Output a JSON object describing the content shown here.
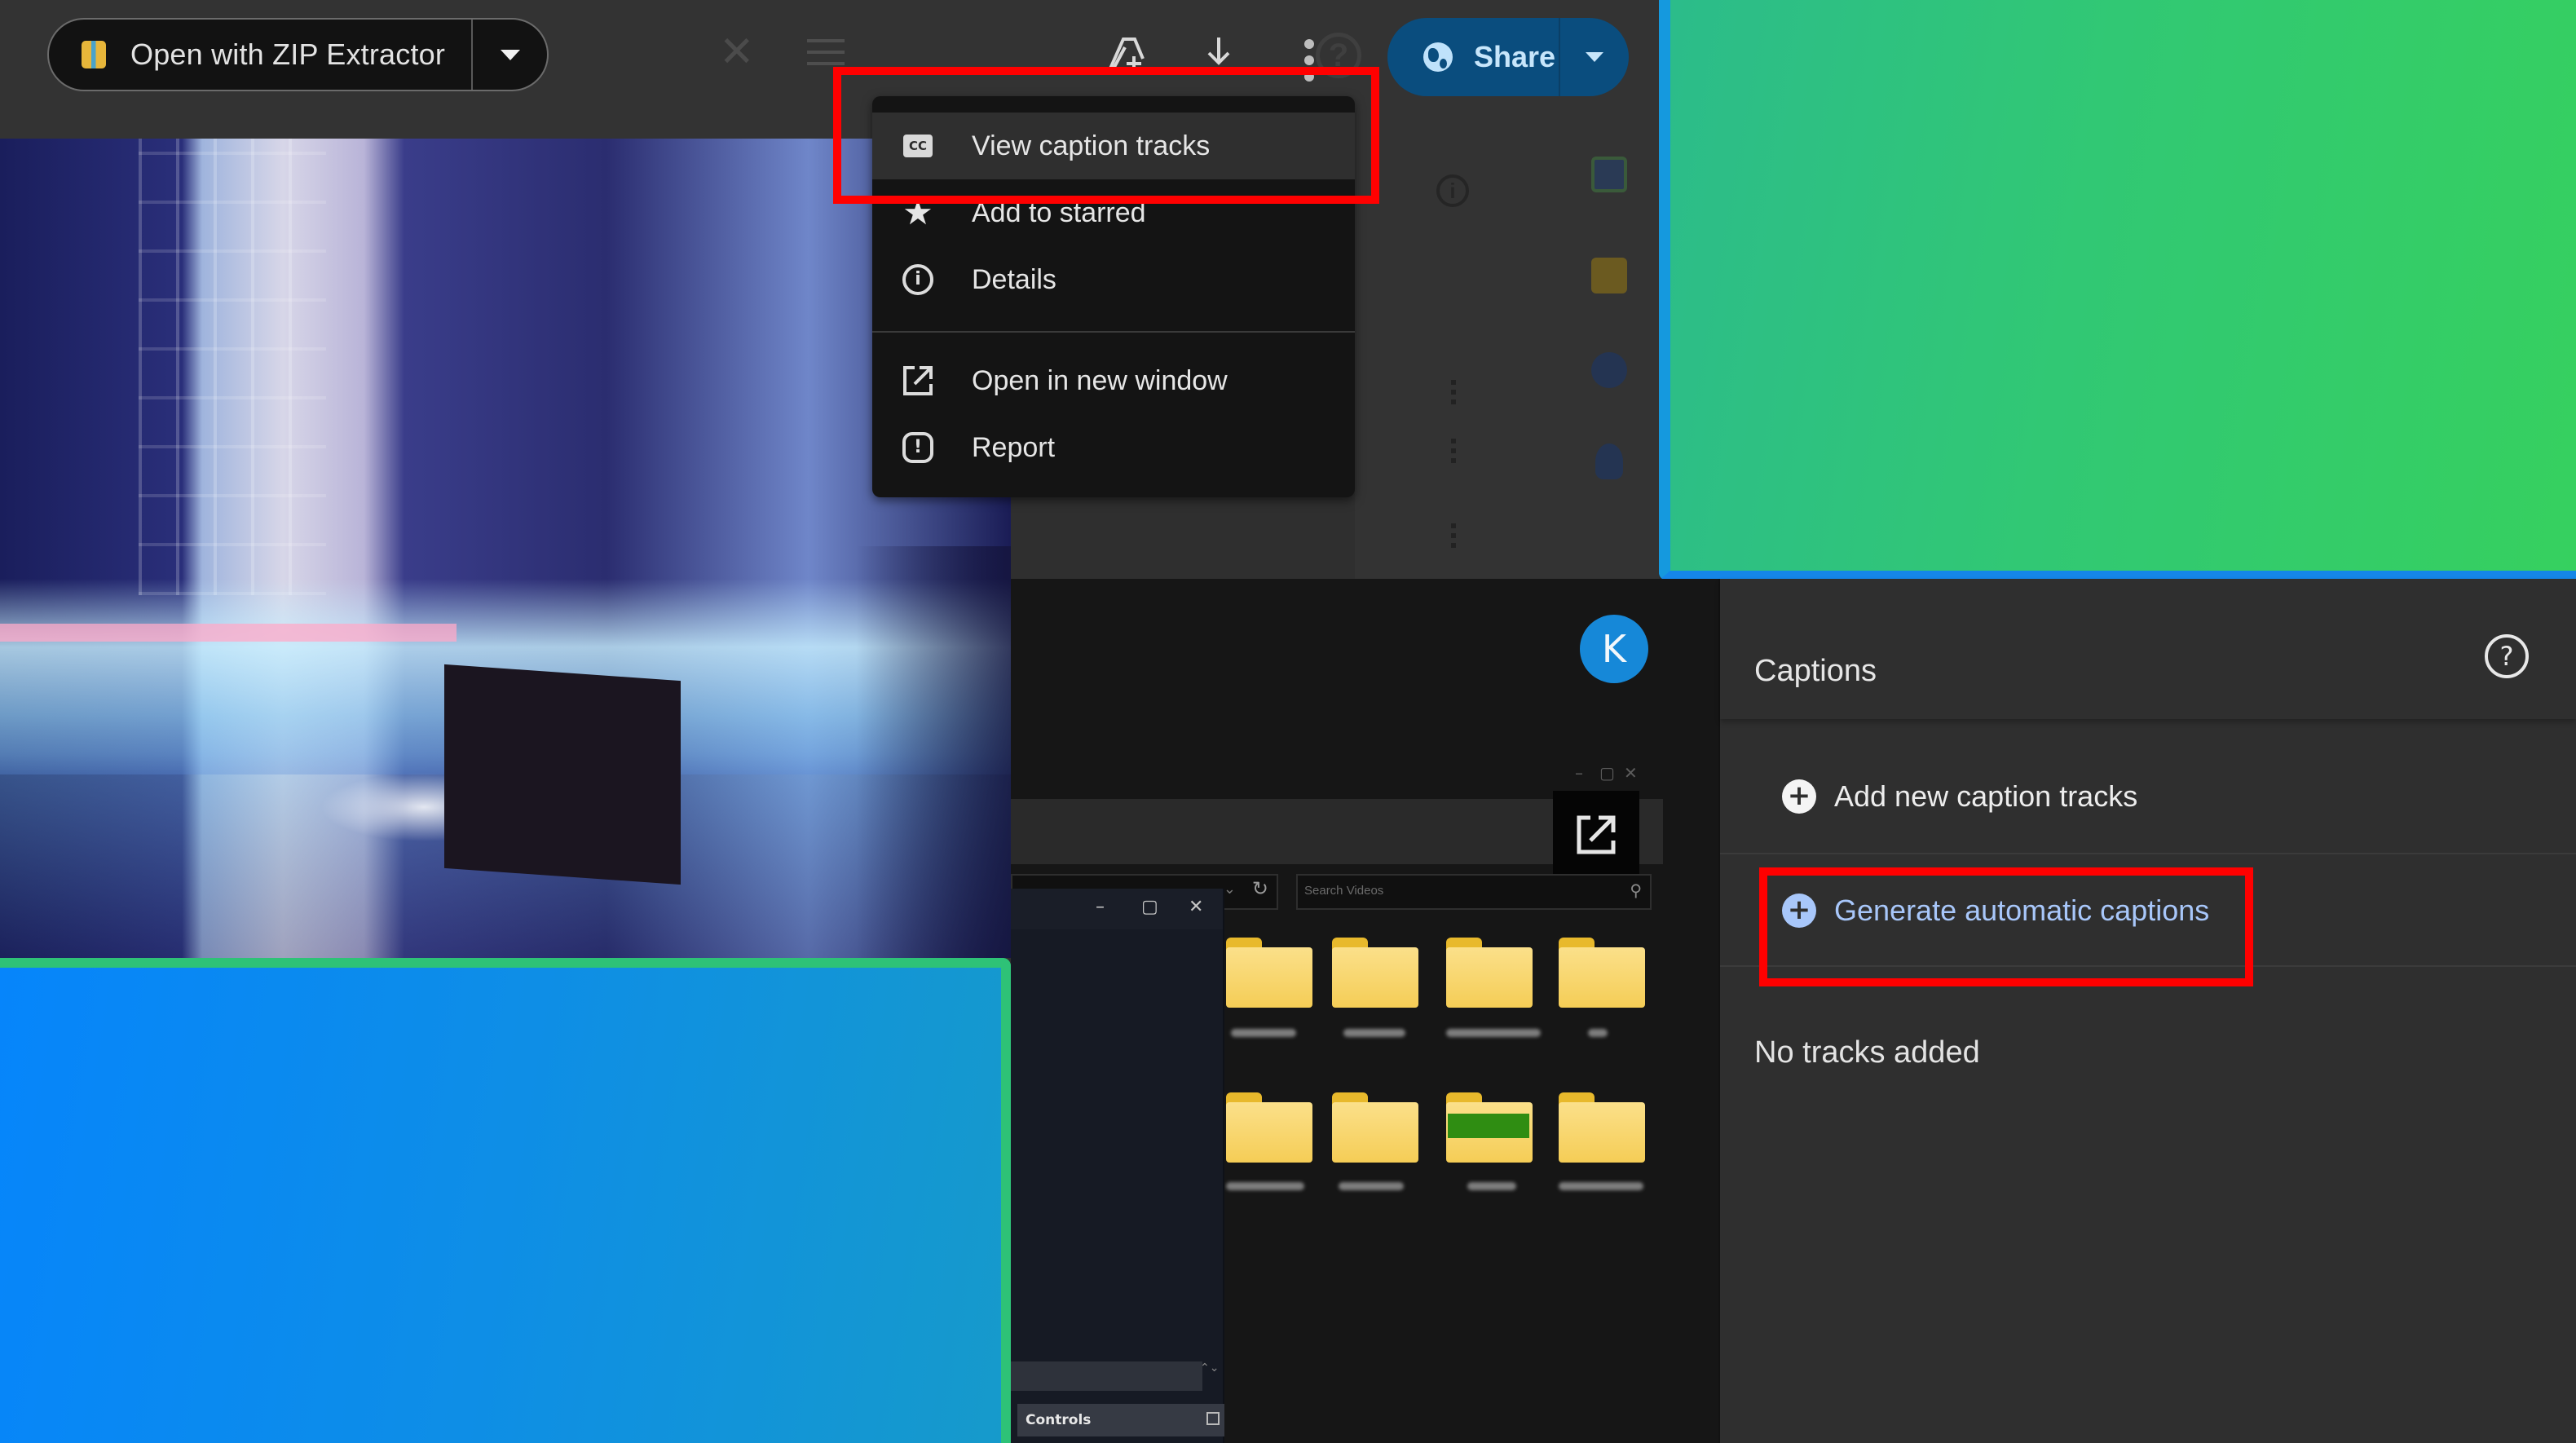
{
  "toolbar": {
    "open_with_label": "Open with ZIP Extractor",
    "open_with_icon": "zip-archive-icon",
    "close_icon": "close-icon",
    "filter_icon": "sliders-icon",
    "add_to_drive_icon": "add-to-drive-icon",
    "download_icon": "download-icon",
    "more_icon": "more-vert-icon",
    "help_icon": "help-icon",
    "share_label": "Share",
    "share_icon": "globe-icon"
  },
  "context_menu": {
    "items": [
      {
        "label": "View caption tracks",
        "icon": "closed-captions-icon",
        "highlighted": true
      },
      {
        "label": "Add to starred",
        "icon": "star-icon"
      },
      {
        "label": "Details",
        "icon": "info-icon"
      },
      {
        "label": "Open in new window",
        "icon": "open-in-new-icon"
      },
      {
        "label": "Report",
        "icon": "report-icon"
      }
    ],
    "glyphs": {
      "cc": "CC",
      "info": "i",
      "report": "!",
      "star": "★"
    }
  },
  "side_panel": {
    "info_glyph": "i",
    "apps": [
      "calendar-icon",
      "keep-icon",
      "tasks-icon",
      "contacts-icon"
    ]
  },
  "embedded_window": {
    "avatar_letter": "K",
    "window_controls": [
      "–",
      "▢",
      "✕"
    ],
    "search_placeholder": "Search Videos",
    "search_glyph": "⚲",
    "refresh_glyph": "↻",
    "chevron_glyph": "⌄",
    "mini_window_controls": [
      "–",
      "▢",
      "✕"
    ],
    "controls_label": "Controls",
    "spinner_glyph": "⌃⌄",
    "folders_row1": 4,
    "folders_row2": 4
  },
  "captions_panel": {
    "title": "Captions",
    "help_glyph": "?",
    "add_label": "Add new caption tracks",
    "generate_label": "Generate automatic captions",
    "plus_glyph": "+",
    "empty_text": "No tracks added"
  },
  "colors": {
    "highlight_box": "#ff0000",
    "share_bg": "#0a4d7e",
    "generate_link": "#a8c7fa",
    "avatar": "#1688d8",
    "green_panel": "#31c874",
    "blue_panel": "#0e8ee6"
  }
}
